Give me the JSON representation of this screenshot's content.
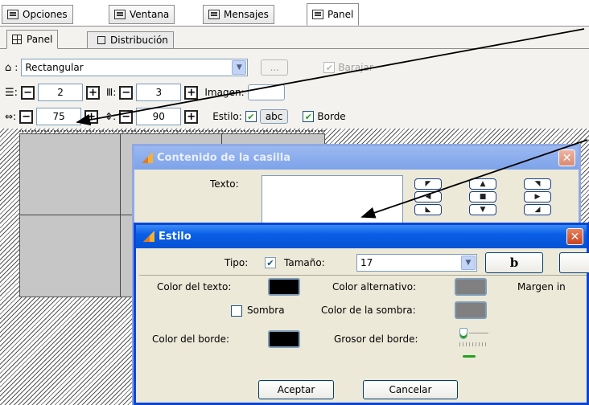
{
  "top_tabs": [
    {
      "label": "Opciones",
      "icon": "options-icon"
    },
    {
      "label": "Ventana",
      "icon": "window-icon"
    },
    {
      "label": "Mensajes",
      "icon": "messages-icon"
    },
    {
      "label": "Panel",
      "icon": "panel-icon"
    }
  ],
  "panel_tabs": [
    {
      "label": "Panel",
      "icon": "grid-icon"
    },
    {
      "label": "Distribución",
      "icon": "distribution-icon"
    }
  ],
  "panel": {
    "shape_label": ":",
    "shape_value": "Rectangular",
    "dots": "...",
    "shuffle_label": "Barajar",
    "rows_value": "2",
    "cols_value": "3",
    "image_label": "Imagen:",
    "width_value": "75",
    "height_value": "90",
    "style_label": "Estilo:",
    "style_sample": "abc",
    "border_label": "Borde"
  },
  "content_dialog": {
    "title": "Contenido de la casilla",
    "text_label": "Texto:",
    "text_value": ""
  },
  "style_dialog": {
    "title": "Estilo",
    "type_label": "Tipo:",
    "size_label": "Tamaño:",
    "size_value": "17",
    "bold_label": "b",
    "text_color_label": "Color del texto:",
    "alt_color_label": "Color alternativo:",
    "margin_label": "Margen in",
    "shadow_label": "Sombra",
    "shadow_color_label": "Color de la sombra:",
    "border_color_label": "Color del borde:",
    "border_width_label": "Grosor del borde:",
    "ok_label": "Aceptar",
    "cancel_label": "Cancelar",
    "colors": {
      "text_color": "#000000",
      "alt_color": "#808080",
      "shadow_color": "#808080",
      "border_color": "#000000"
    }
  },
  "colors": {
    "title_active": "#0552d5",
    "close_button": "#c9431e",
    "check_green": "#21a121",
    "dialog_bg": "#ece9d8"
  }
}
